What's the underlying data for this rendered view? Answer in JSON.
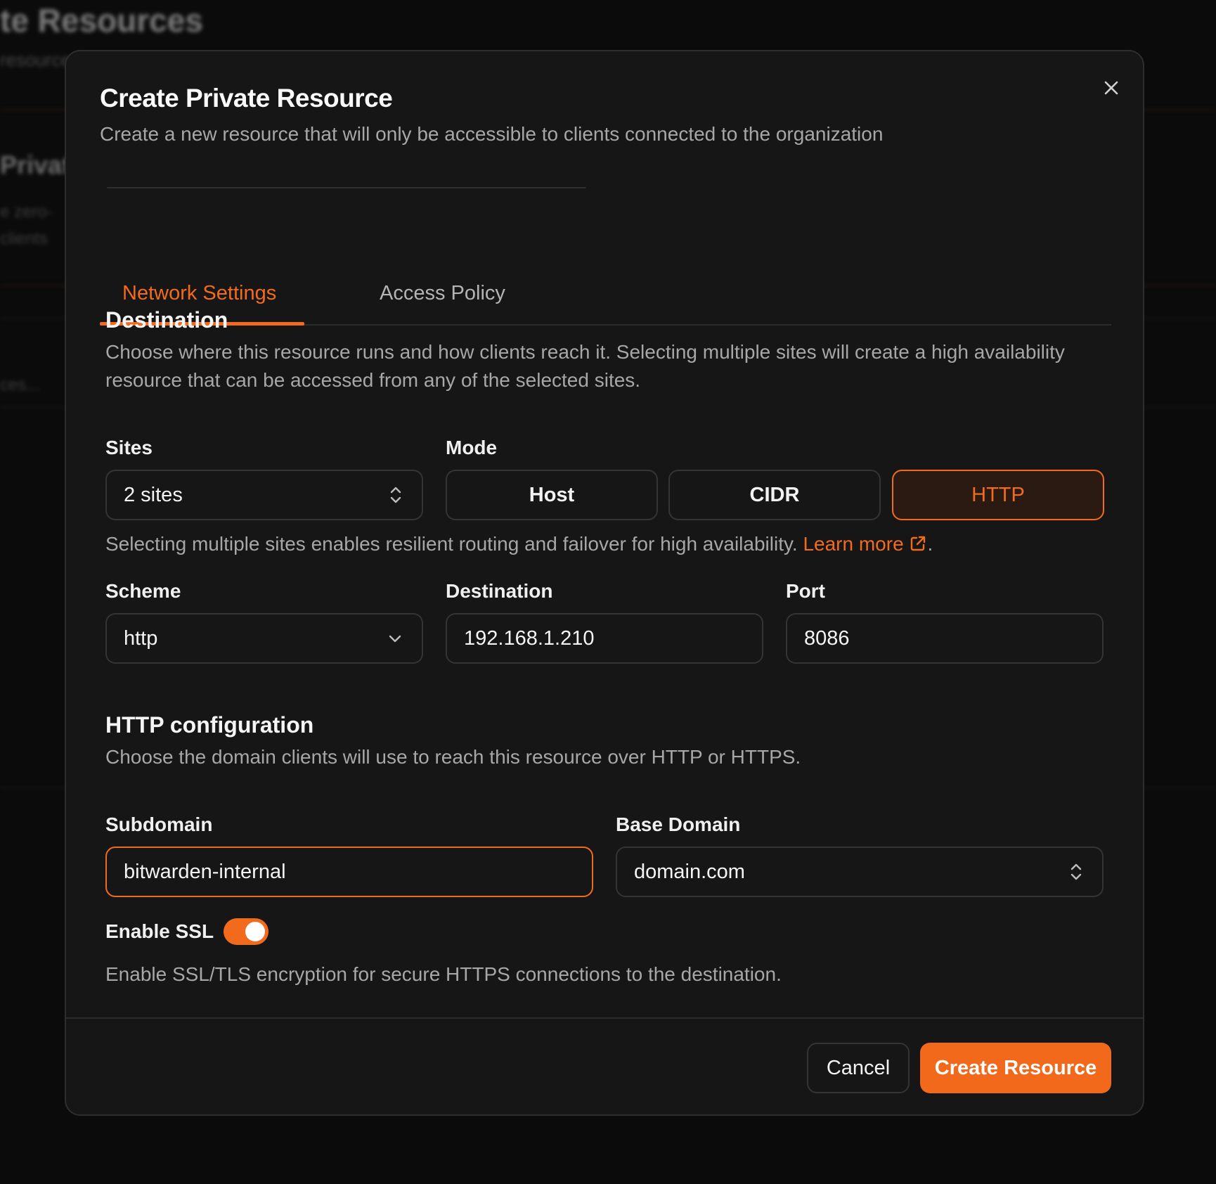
{
  "background": {
    "title": "te Resources",
    "subtitle": "resources",
    "heading": "Private",
    "text1": "e zero-",
    "text2": "clients",
    "text3": "ces..."
  },
  "modal": {
    "title": "Create Private Resource",
    "subtitle": "Create a new resource that will only be accessible to clients connected to the organization",
    "close_icon": "close-icon"
  },
  "tabs": [
    {
      "label": "Network Settings",
      "active": true
    },
    {
      "label": "Access Policy",
      "active": false
    }
  ],
  "destination_section": {
    "heading": "Destination",
    "description_line1": "Choose where this resource runs and how clients reach it. Selecting multiple sites will create a high availability",
    "description_line2": "resource that can be accessed from any of the selected sites."
  },
  "sites": {
    "label": "Sites",
    "value": "2 sites",
    "icon": "chevrons-up-down-icon"
  },
  "mode": {
    "label": "Mode",
    "options": [
      "Host",
      "CIDR",
      "HTTP"
    ],
    "selected": "HTTP"
  },
  "helper": {
    "text": "Selecting multiple sites enables resilient routing and failover for high availability.",
    "link": "Learn more",
    "link_icon": "external-link-icon",
    "suffix": "."
  },
  "scheme": {
    "label": "Scheme",
    "value": "http",
    "icon": "chevron-down-icon"
  },
  "destination": {
    "label": "Destination",
    "value": "192.168.1.210"
  },
  "port": {
    "label": "Port",
    "value": "8086"
  },
  "http_config": {
    "heading": "HTTP configuration",
    "description": "Choose the domain clients will use to reach this resource over HTTP or HTTPS."
  },
  "subdomain": {
    "label": "Subdomain",
    "value": "bitwarden-internal"
  },
  "base_domain": {
    "label": "Base Domain",
    "value": "domain.com",
    "icon": "chevrons-up-down-icon"
  },
  "ssl": {
    "label": "Enable SSL",
    "enabled": true,
    "description": "Enable SSL/TLS encryption for secure HTTPS connections to the destination."
  },
  "footer": {
    "cancel_label": "Cancel",
    "create_label": "Create Resource"
  },
  "colors": {
    "accent": "#f26b1d",
    "background": "#161616",
    "border": "#343434"
  }
}
